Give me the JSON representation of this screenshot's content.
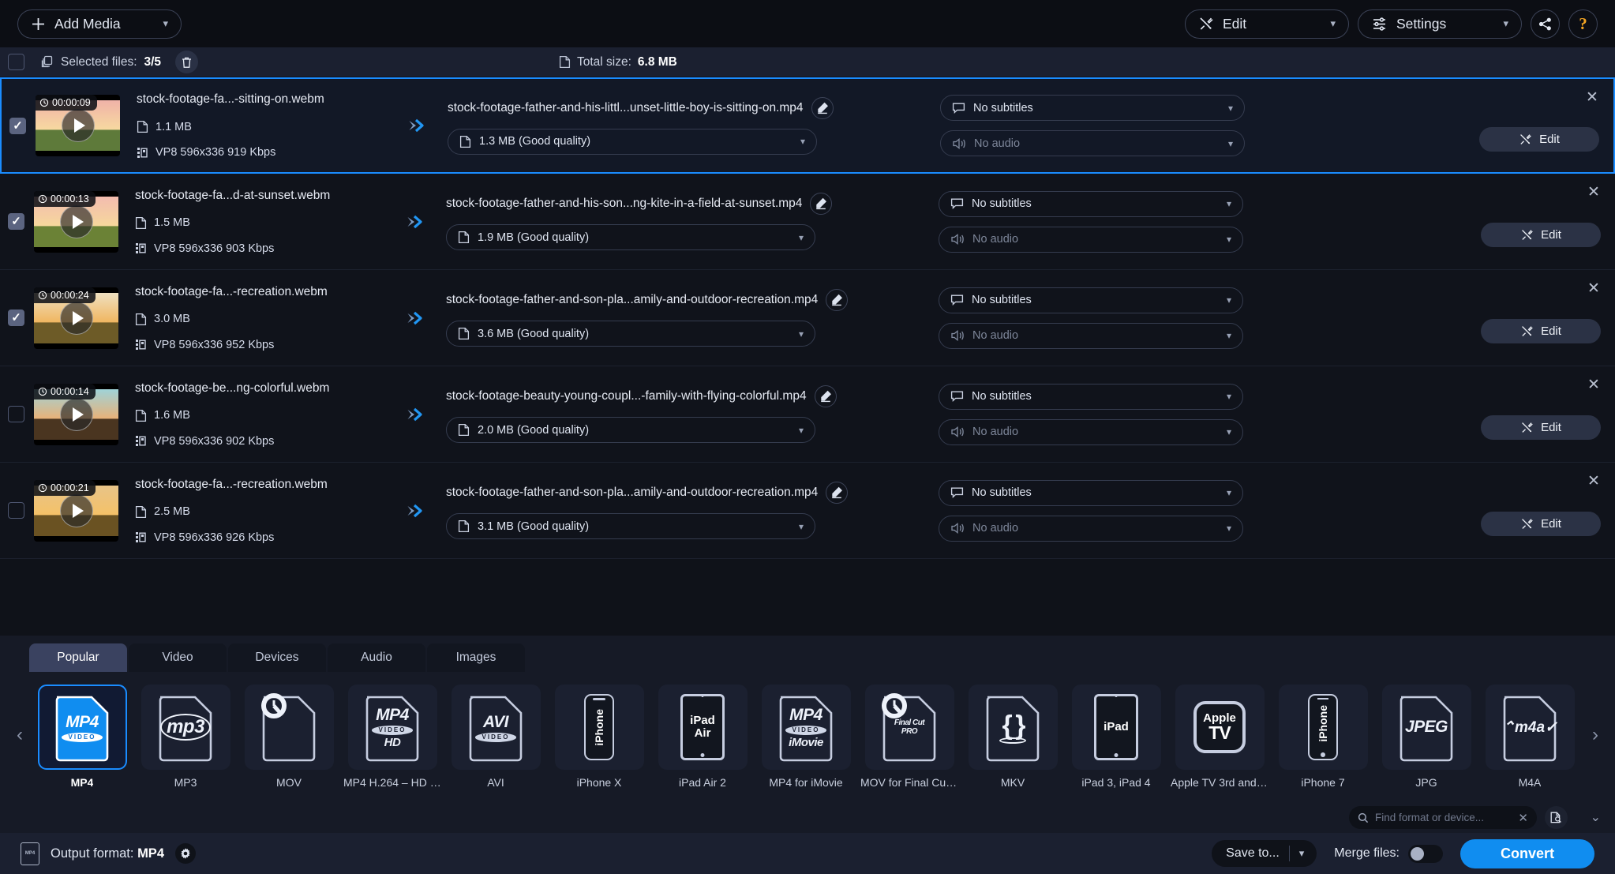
{
  "topbar": {
    "add_media_label": "Add Media",
    "edit_label": "Edit",
    "settings_label": "Settings",
    "share_icon": "share-icon",
    "help_label": "?"
  },
  "selectbar": {
    "selected_label": "Selected files:",
    "selected_count": "3/5",
    "total_size_label": "Total size:",
    "total_size_value": "6.8 MB",
    "trash_icon": "trash-icon"
  },
  "files": [
    {
      "checked": true,
      "selected": true,
      "duration": "00:00:09",
      "source_name": "stock-footage-fa...-sitting-on.webm",
      "source_size": "1.1 MB",
      "source_meta": "VP8 596x336 919 Kbps",
      "output_name": "stock-footage-father-and-his-littl...unset-little-boy-is-sitting-on.mp4",
      "output_quality": "1.3 MB (Good quality)",
      "subtitles": "No subtitles",
      "audio": "No audio",
      "edit_label": "Edit",
      "thumb_sky_top": "#f0b2a8",
      "thumb_sky_bottom": "#f7d9a0",
      "thumb_ground": "#5e7a3a"
    },
    {
      "checked": true,
      "selected": false,
      "duration": "00:00:13",
      "source_name": "stock-footage-fa...d-at-sunset.webm",
      "source_size": "1.5 MB",
      "source_meta": "VP8 596x336 903 Kbps",
      "output_name": "stock-footage-father-and-his-son...ng-kite-in-a-field-at-sunset.mp4",
      "output_quality": "1.9 MB (Good quality)",
      "subtitles": "No subtitles",
      "audio": "No audio",
      "edit_label": "Edit",
      "thumb_sky_top": "#f3bcb0",
      "thumb_sky_bottom": "#f6d79c",
      "thumb_ground": "#6b8236"
    },
    {
      "checked": true,
      "selected": false,
      "duration": "00:00:24",
      "source_name": "stock-footage-fa...-recreation.webm",
      "source_size": "3.0 MB",
      "source_meta": "VP8 596x336 952 Kbps",
      "output_name": "stock-footage-father-and-son-pla...amily-and-outdoor-recreation.mp4",
      "output_quality": "3.6 MB (Good quality)",
      "subtitles": "No subtitles",
      "audio": "No audio",
      "edit_label": "Edit",
      "thumb_sky_top": "#efe0c0",
      "thumb_sky_bottom": "#f0b660",
      "thumb_ground": "#6d5b27"
    },
    {
      "checked": false,
      "selected": false,
      "duration": "00:00:14",
      "source_name": "stock-footage-be...ng-colorful.webm",
      "source_size": "1.6 MB",
      "source_meta": "VP8 596x336 902 Kbps",
      "output_name": "stock-footage-beauty-young-coupl...-family-with-flying-colorful.mp4",
      "output_quality": "2.0 MB (Good quality)",
      "subtitles": "No subtitles",
      "audio": "No audio",
      "edit_label": "Edit",
      "thumb_sky_top": "#9fd3d8",
      "thumb_sky_bottom": "#e8b279",
      "thumb_ground": "#4a3520"
    },
    {
      "checked": false,
      "selected": false,
      "duration": "00:00:21",
      "source_name": "stock-footage-fa...-recreation.webm",
      "source_size": "2.5 MB",
      "source_meta": "VP8 596x336 926 Kbps",
      "output_name": "stock-footage-father-and-son-pla...amily-and-outdoor-recreation.mp4",
      "output_quality": "3.1 MB (Good quality)",
      "subtitles": "No subtitles",
      "audio": "No audio",
      "edit_label": "Edit",
      "thumb_sky_top": "#e8c488",
      "thumb_sky_bottom": "#f4c168",
      "thumb_ground": "#6a5222"
    }
  ],
  "bottom": {
    "tabs": [
      {
        "label": "Popular",
        "active": true
      },
      {
        "label": "Video",
        "active": false
      },
      {
        "label": "Devices",
        "active": false
      },
      {
        "label": "Audio",
        "active": false
      },
      {
        "label": "Images",
        "active": false
      }
    ],
    "search_placeholder": "Find format or device...",
    "search_value": "",
    "search_icon": "search-icon",
    "clear_icon": "close-icon",
    "preset_search_icon": "file-search-icon",
    "collapse_icon": "chevron-down-icon",
    "prev_arrow": "chevron-left-icon",
    "next_arrow": "chevron-right-icon",
    "formats": [
      {
        "label": "MP4",
        "icon": "mp4-file-icon",
        "glyph": "MP4",
        "band": "VIDEO",
        "active": true,
        "kind": "file"
      },
      {
        "label": "MP3",
        "icon": "mp3-file-icon",
        "glyph": "mp3",
        "band": "",
        "active": false,
        "kind": "mp3"
      },
      {
        "label": "MOV",
        "icon": "mov-quicktime-file-icon",
        "glyph": "Q",
        "band": "",
        "active": false,
        "kind": "qt"
      },
      {
        "label": "MP4 H.264 – HD 7...",
        "icon": "mp4-hd-file-icon",
        "glyph": "MP4",
        "band": "VIDEO",
        "active": false,
        "kind": "file",
        "sub": "HD"
      },
      {
        "label": "AVI",
        "icon": "avi-file-icon",
        "glyph": "AVI",
        "band": "VIDEO",
        "active": false,
        "kind": "file"
      },
      {
        "label": "iPhone X",
        "icon": "iphone-x-device-icon",
        "glyph": "iPhone",
        "band": "",
        "active": false,
        "kind": "phone-x"
      },
      {
        "label": "iPad Air 2",
        "icon": "ipad-air-device-icon",
        "glyph": "iPad Air",
        "band": "",
        "active": false,
        "kind": "tablet"
      },
      {
        "label": "MP4 for iMovie",
        "icon": "mp4-imovie-file-icon",
        "glyph": "MP4",
        "band": "VIDEO",
        "active": false,
        "kind": "file",
        "sub": "iMovie"
      },
      {
        "label": "MOV for Final Cut ...",
        "icon": "mov-finalcut-file-icon",
        "glyph": "Q",
        "band": "",
        "active": false,
        "kind": "qt",
        "sub": "Final Cut PRO"
      },
      {
        "label": "MKV",
        "icon": "mkv-file-icon",
        "glyph": "{}",
        "band": "",
        "active": false,
        "kind": "mkv"
      },
      {
        "label": "iPad 3, iPad 4",
        "icon": "ipad-device-icon",
        "glyph": "iPad",
        "band": "",
        "active": false,
        "kind": "tablet"
      },
      {
        "label": "Apple TV 3rd and ...",
        "icon": "apple-tv-device-icon",
        "glyph": "Apple TV",
        "band": "",
        "active": false,
        "kind": "appletv"
      },
      {
        "label": "iPhone 7",
        "icon": "iphone-7-device-icon",
        "glyph": "iPhone",
        "band": "",
        "active": false,
        "kind": "phone-7"
      },
      {
        "label": "JPG",
        "icon": "jpeg-file-icon",
        "glyph": "JPEG",
        "band": "",
        "active": false,
        "kind": "file"
      },
      {
        "label": "M4A",
        "icon": "m4a-file-icon",
        "glyph": "m4a",
        "band": "",
        "active": false,
        "kind": "m4a"
      }
    ]
  },
  "statusbar": {
    "output_format_label": "Output format:",
    "output_format_value": "MP4",
    "gear_icon": "gear-icon",
    "save_to_label": "Save to...",
    "merge_label": "Merge files:",
    "merge_on": false,
    "convert_label": "Convert"
  },
  "colors": {
    "accent": "#108df0",
    "selected_border": "#1a8cff",
    "help": "#f5a623",
    "panel": "#161a26",
    "row": "#10131b"
  }
}
